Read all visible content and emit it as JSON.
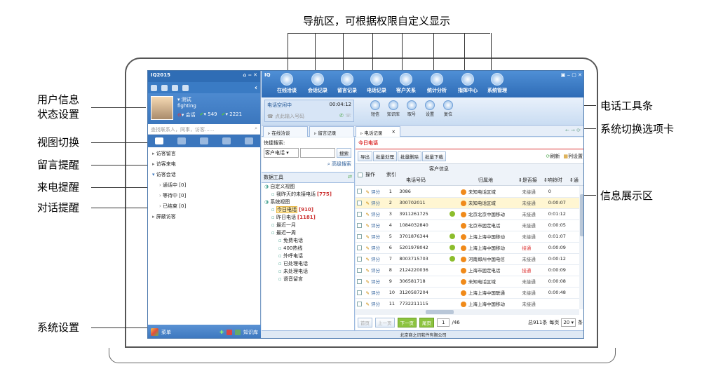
{
  "annotations": {
    "top": "导航区，可根据权限自定义显示",
    "left": [
      {
        "name": "user-info-annotation",
        "lines": [
          "用户信息",
          "状态设置"
        ]
      },
      {
        "name": "view-switch-annotation",
        "lines": [
          "视图切换"
        ]
      },
      {
        "name": "message-reminder-annotation",
        "lines": [
          "留言提醒"
        ]
      },
      {
        "name": "call-reminder-annotation",
        "lines": [
          "来电提醒"
        ]
      },
      {
        "name": "chat-reminder-annotation",
        "lines": [
          "对话提醒"
        ]
      },
      {
        "name": "system-settings-annotation",
        "lines": [
          "系统设置"
        ]
      }
    ],
    "right": [
      {
        "name": "phone-toolbar-annotation",
        "text": "电话工具条"
      },
      {
        "name": "system-tab-annotation",
        "text": "系统切换选项卡"
      },
      {
        "name": "info-area-annotation",
        "text": "信息展示区"
      }
    ]
  },
  "left_panel": {
    "app_title": "IQ2015",
    "user": {
      "name": "测试",
      "signature": "fighting",
      "status_label": "会话",
      "count1": "549",
      "count2": "2221"
    },
    "search_placeholder": "查找联系人，同事，访客......",
    "tree": [
      {
        "label": "访客留言",
        "indent": 0,
        "arrow": "▸"
      },
      {
        "label": "访客来电",
        "indent": 0,
        "arrow": "▸"
      },
      {
        "label": "访客会话",
        "indent": 0,
        "arrow": "▾"
      },
      {
        "label": "通话中 [0]",
        "indent": 1,
        "arrow": "›"
      },
      {
        "label": "等待中 [0]",
        "indent": 1,
        "arrow": "›"
      },
      {
        "label": "已结束 [0]",
        "indent": 1,
        "arrow": "›"
      },
      {
        "label": "屏蔽访客",
        "indent": 0,
        "arrow": "▸"
      }
    ],
    "menu_label": "菜单",
    "kb_label": "知识库"
  },
  "nav": {
    "app_title": "IQ",
    "items": [
      "在线洽谈",
      "会话记录",
      "留言记录",
      "电话记录",
      "客户关系",
      "统计分析",
      "指挥中心",
      "系统管理"
    ]
  },
  "phonebar": {
    "status": "电话空闲中",
    "timer": "00:04:12",
    "input_placeholder": "点此输入号码",
    "buttons": [
      "短信",
      "知识库",
      "取号",
      "设置",
      "复位"
    ]
  },
  "tabs": [
    "在线洽谈",
    "留言记录",
    "电话记录"
  ],
  "mid": {
    "quick_search_label": "快捷搜索:",
    "select_value": "客户电话",
    "search_btn": "搜索",
    "advanced_search": "高级搜索",
    "tools_label": "数据工具",
    "tree": [
      {
        "label": "自定义视图",
        "indent": 0,
        "extra": ""
      },
      {
        "label": "我昨天的未接电话",
        "indent": 1,
        "extra": "[775]"
      },
      {
        "label": "系统视图",
        "indent": 0,
        "extra": ""
      },
      {
        "label": "今日电话",
        "indent": 1,
        "extra": "[910]"
      },
      {
        "label": "昨日电话",
        "indent": 1,
        "extra": "[1181]"
      },
      {
        "label": "最近一月",
        "indent": 1,
        "extra": ""
      },
      {
        "label": "最近一周",
        "indent": 1,
        "extra": ""
      },
      {
        "label": "免费电话",
        "indent": 2,
        "extra": ""
      },
      {
        "label": "400热线",
        "indent": 2,
        "extra": ""
      },
      {
        "label": "外呼电话",
        "indent": 2,
        "extra": ""
      },
      {
        "label": "已处理电话",
        "indent": 2,
        "extra": ""
      },
      {
        "label": "未处理电话",
        "indent": 2,
        "extra": ""
      },
      {
        "label": "语音留言",
        "indent": 2,
        "extra": ""
      }
    ]
  },
  "table": {
    "title": "今日电话",
    "toolbar": [
      "导出",
      "批量处理",
      "批量删除",
      "批量下载"
    ],
    "refresh": "刷新",
    "col_settings": "列设置",
    "header_group": "客户信息",
    "headers": [
      "操作",
      "索引",
      "电话号码",
      "归属地",
      "是否接",
      "响铃时",
      "通"
    ],
    "rate_label": "评分",
    "rows": [
      {
        "idx": "1",
        "phone": "3086",
        "loc": "未知电话区域",
        "status": "未接通",
        "ring": "0"
      },
      {
        "idx": "2",
        "phone": "300702011",
        "loc": "未知电话区域",
        "status": "未接通",
        "ring": "0:00:07"
      },
      {
        "idx": "3",
        "phone": "3911261725",
        "loc": "北京北京中国移动",
        "status": "未接通",
        "ring": "0:01:12"
      },
      {
        "idx": "4",
        "phone": "1084032840",
        "loc": "北京市固定电话",
        "status": "未接通",
        "ring": "0:00:05"
      },
      {
        "idx": "5",
        "phone": "3701876344",
        "loc": "上海上海中国移动",
        "status": "未接通",
        "ring": "0:01:07"
      },
      {
        "idx": "6",
        "phone": "5201978042",
        "loc": "上海上海中国移动",
        "status": "接通",
        "ring": "0:00:09"
      },
      {
        "idx": "7",
        "phone": "8003715703",
        "loc": "河南郑州中国电信",
        "status": "未接通",
        "ring": "0:00:12"
      },
      {
        "idx": "8",
        "phone": "2124220036",
        "loc": "上海市固定电话",
        "status": "接通",
        "ring": "0:00:09"
      },
      {
        "idx": "9",
        "phone": "306581718",
        "loc": "未知电话区域",
        "status": "未接通",
        "ring": "0:00:08"
      },
      {
        "idx": "10",
        "phone": "3120587204",
        "loc": "上海上海中国联通",
        "status": "未接通",
        "ring": "0:00:48"
      },
      {
        "idx": "11",
        "phone": "7732211115",
        "loc": "上海上海中国移动",
        "status": "未接通",
        "ring": ""
      }
    ],
    "pager": {
      "first": "首页",
      "prev": "上一页",
      "next": "下一页",
      "last": "尾页",
      "page": "1",
      "total_pages": "/46",
      "total": "总911条",
      "per_page_label": "每页",
      "per_page": "20",
      "suffix": "条"
    }
  },
  "footer": "北京商之讯软件有限公司"
}
